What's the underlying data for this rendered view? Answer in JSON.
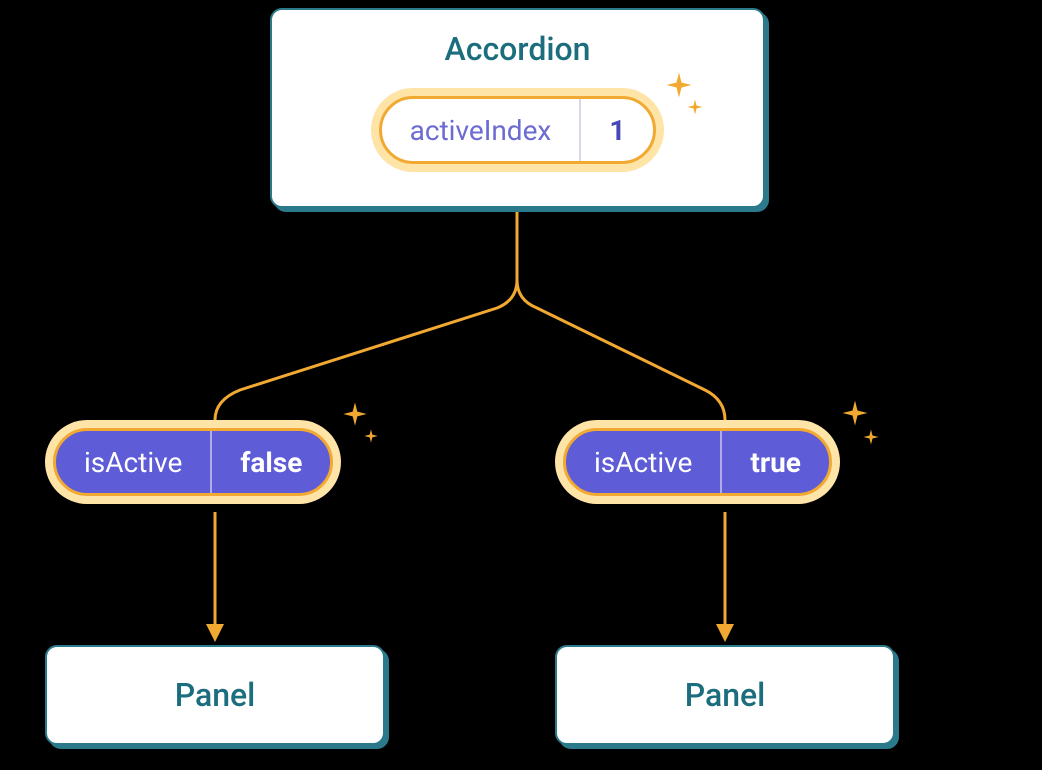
{
  "accordion": {
    "title": "Accordion",
    "state": {
      "label": "activeIndex",
      "value": "1"
    }
  },
  "panels": [
    {
      "prop": {
        "label": "isActive",
        "value": "false"
      },
      "name": "Panel"
    },
    {
      "prop": {
        "label": "isActive",
        "value": "true"
      },
      "name": "Panel"
    }
  ]
}
